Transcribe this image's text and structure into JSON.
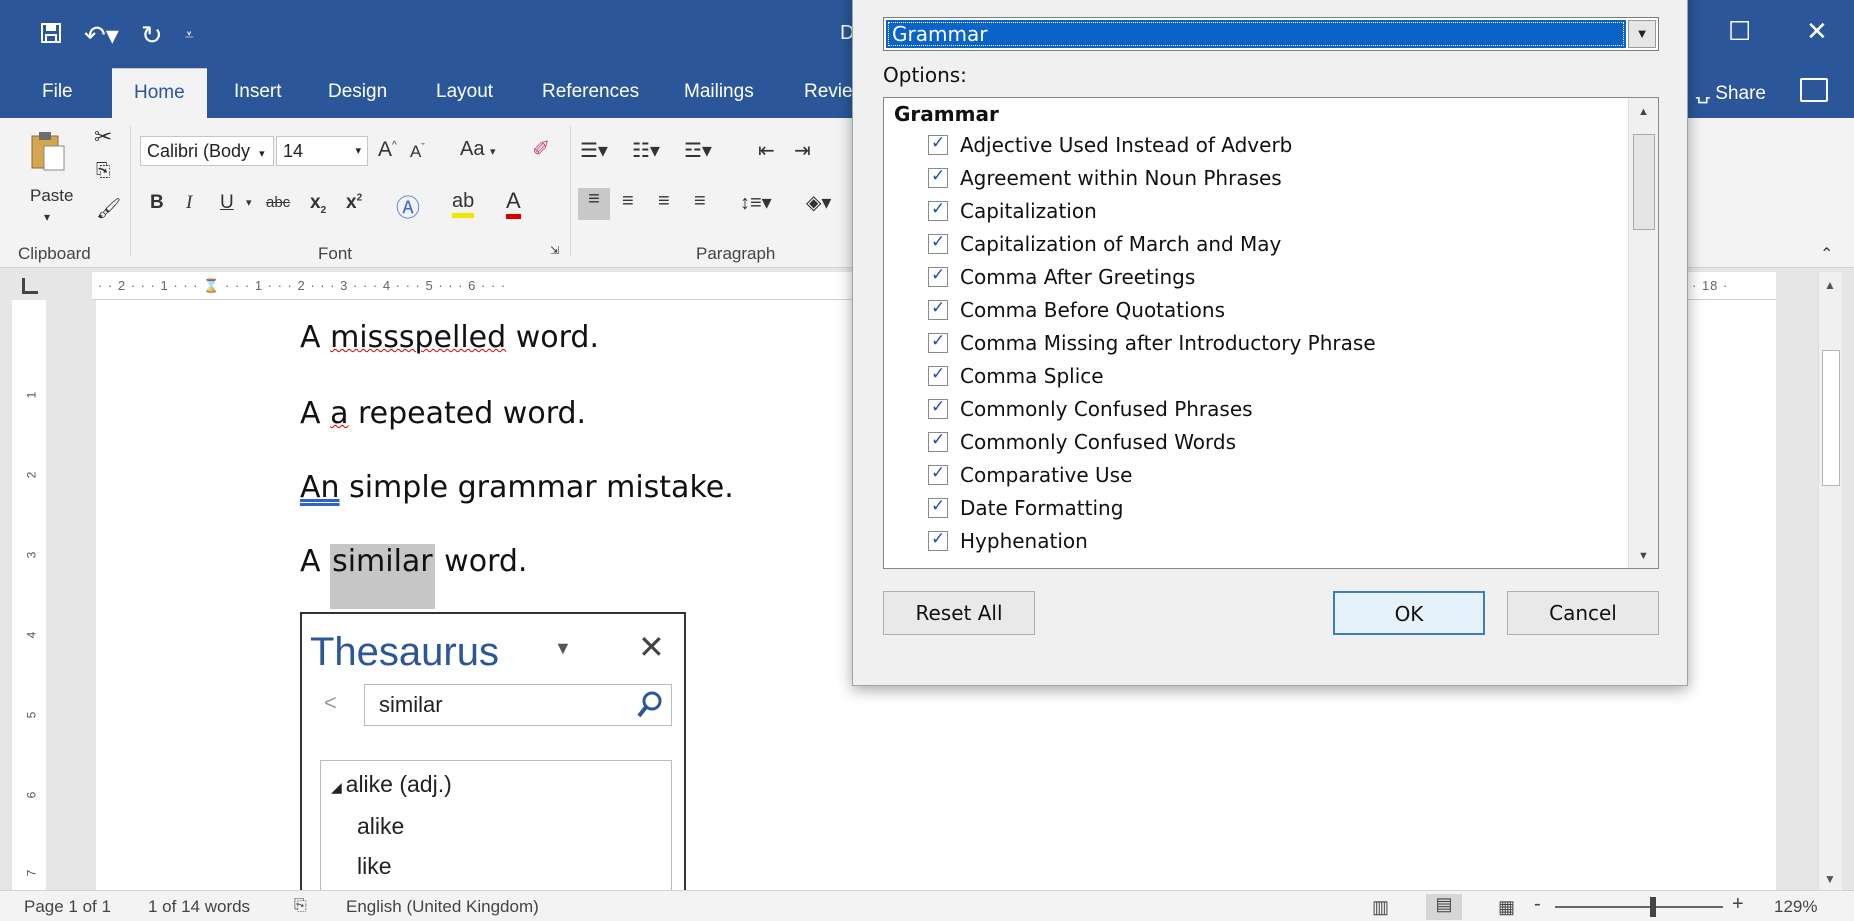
{
  "title_bar": {
    "doc_title_fragment": "D",
    "qat_icons": [
      "save-icon",
      "undo-icon",
      "redo-icon",
      "customize-qat-icon"
    ],
    "window_controls": [
      "restore-icon",
      "close-icon"
    ]
  },
  "tabs": [
    "File",
    "Home",
    "Insert",
    "Design",
    "Layout",
    "References",
    "Mailings",
    "Revie"
  ],
  "share_label": "Share",
  "ribbon": {
    "paste_label": "Paste",
    "font_name": "Calibri (Body",
    "font_size": "14",
    "grow_font": "A",
    "shrink_font": "A",
    "change_case": "Aa",
    "bold": "B",
    "italic": "I",
    "underline": "U",
    "strikethrough": "abc",
    "subscript": "x",
    "superscript": "x",
    "font_color_label": "A",
    "groups": {
      "clipboard": "Clipboard",
      "font": "Font",
      "paragraph": "Paragraph"
    }
  },
  "ruler": {
    "horizontal_text": "· · 2 · · · 1 · · · ⌛ · · · 1 · · · 2 · · · 3 · · · 4 · · · 5 · · · 6 · · ·",
    "right_marker": "· 18 ·",
    "vertical_numbers": [
      "1",
      "2",
      "3",
      "4",
      "5",
      "6",
      "7"
    ]
  },
  "document": {
    "line1": {
      "a": "A ",
      "misspelled": "missspelled",
      "rest": " word."
    },
    "line2": {
      "a": "A ",
      "repeated": "a",
      "rest": " repeated word."
    },
    "line3": {
      "an": "An",
      "rest": " simple grammar mistake."
    },
    "line4": {
      "a": "A ",
      "highlight": "similar",
      "rest": " word."
    }
  },
  "thesaurus": {
    "title": "Thesaurus",
    "search_value": "similar",
    "results": [
      {
        "label": "alike (adj.)",
        "header": true
      },
      {
        "label": "alike",
        "header": false
      },
      {
        "label": "like",
        "header": false
      }
    ]
  },
  "dialog": {
    "style_value": "Grammar",
    "options_label": "Options:",
    "list_heading": "Grammar",
    "options": [
      "Adjective Used Instead of Adverb",
      "Agreement within Noun Phrases",
      "Capitalization",
      "Capitalization of March and May",
      "Comma After Greetings",
      "Comma Before Quotations",
      "Comma Missing after Introductory Phrase",
      "Comma Splice",
      "Commonly Confused Phrases",
      "Commonly Confused Words",
      "Comparative Use",
      "Date Formatting",
      "Hyphenation"
    ],
    "buttons": {
      "reset": "Reset All",
      "ok": "OK",
      "cancel": "Cancel"
    }
  },
  "status_bar": {
    "page": "Page 1 of 1",
    "words": "1 of 14 words",
    "language": "English (United Kingdom)",
    "zoom": "129%"
  }
}
